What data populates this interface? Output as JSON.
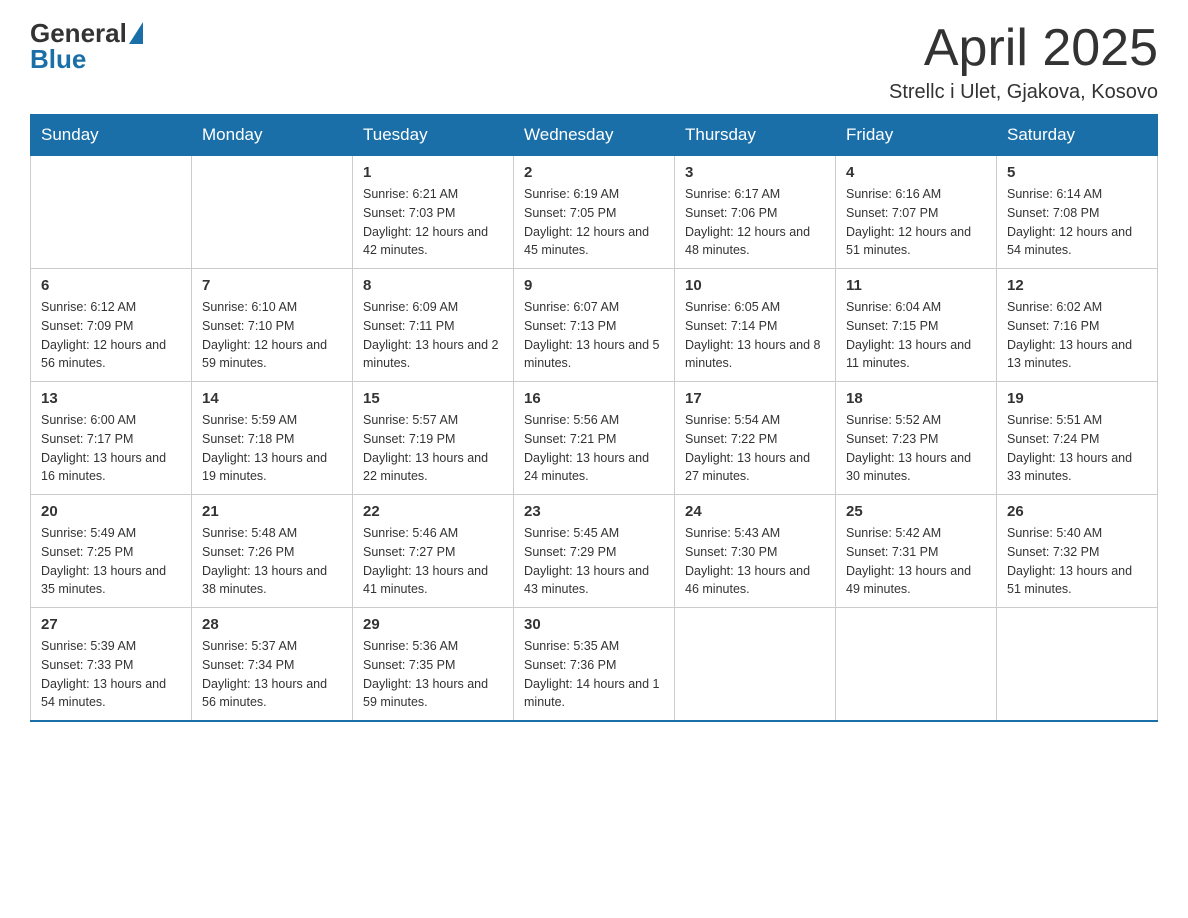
{
  "header": {
    "logo": {
      "general": "General",
      "blue": "Blue",
      "triangle_symbol": "▲"
    },
    "month_title": "April 2025",
    "location": "Strellc i Ulet, Gjakova, Kosovo"
  },
  "weekdays": [
    "Sunday",
    "Monday",
    "Tuesday",
    "Wednesday",
    "Thursday",
    "Friday",
    "Saturday"
  ],
  "weeks": [
    [
      {
        "day": "",
        "sunrise": "",
        "sunset": "",
        "daylight": ""
      },
      {
        "day": "",
        "sunrise": "",
        "sunset": "",
        "daylight": ""
      },
      {
        "day": "1",
        "sunrise": "Sunrise: 6:21 AM",
        "sunset": "Sunset: 7:03 PM",
        "daylight": "Daylight: 12 hours and 42 minutes."
      },
      {
        "day": "2",
        "sunrise": "Sunrise: 6:19 AM",
        "sunset": "Sunset: 7:05 PM",
        "daylight": "Daylight: 12 hours and 45 minutes."
      },
      {
        "day": "3",
        "sunrise": "Sunrise: 6:17 AM",
        "sunset": "Sunset: 7:06 PM",
        "daylight": "Daylight: 12 hours and 48 minutes."
      },
      {
        "day": "4",
        "sunrise": "Sunrise: 6:16 AM",
        "sunset": "Sunset: 7:07 PM",
        "daylight": "Daylight: 12 hours and 51 minutes."
      },
      {
        "day": "5",
        "sunrise": "Sunrise: 6:14 AM",
        "sunset": "Sunset: 7:08 PM",
        "daylight": "Daylight: 12 hours and 54 minutes."
      }
    ],
    [
      {
        "day": "6",
        "sunrise": "Sunrise: 6:12 AM",
        "sunset": "Sunset: 7:09 PM",
        "daylight": "Daylight: 12 hours and 56 minutes."
      },
      {
        "day": "7",
        "sunrise": "Sunrise: 6:10 AM",
        "sunset": "Sunset: 7:10 PM",
        "daylight": "Daylight: 12 hours and 59 minutes."
      },
      {
        "day": "8",
        "sunrise": "Sunrise: 6:09 AM",
        "sunset": "Sunset: 7:11 PM",
        "daylight": "Daylight: 13 hours and 2 minutes."
      },
      {
        "day": "9",
        "sunrise": "Sunrise: 6:07 AM",
        "sunset": "Sunset: 7:13 PM",
        "daylight": "Daylight: 13 hours and 5 minutes."
      },
      {
        "day": "10",
        "sunrise": "Sunrise: 6:05 AM",
        "sunset": "Sunset: 7:14 PM",
        "daylight": "Daylight: 13 hours and 8 minutes."
      },
      {
        "day": "11",
        "sunrise": "Sunrise: 6:04 AM",
        "sunset": "Sunset: 7:15 PM",
        "daylight": "Daylight: 13 hours and 11 minutes."
      },
      {
        "day": "12",
        "sunrise": "Sunrise: 6:02 AM",
        "sunset": "Sunset: 7:16 PM",
        "daylight": "Daylight: 13 hours and 13 minutes."
      }
    ],
    [
      {
        "day": "13",
        "sunrise": "Sunrise: 6:00 AM",
        "sunset": "Sunset: 7:17 PM",
        "daylight": "Daylight: 13 hours and 16 minutes."
      },
      {
        "day": "14",
        "sunrise": "Sunrise: 5:59 AM",
        "sunset": "Sunset: 7:18 PM",
        "daylight": "Daylight: 13 hours and 19 minutes."
      },
      {
        "day": "15",
        "sunrise": "Sunrise: 5:57 AM",
        "sunset": "Sunset: 7:19 PM",
        "daylight": "Daylight: 13 hours and 22 minutes."
      },
      {
        "day": "16",
        "sunrise": "Sunrise: 5:56 AM",
        "sunset": "Sunset: 7:21 PM",
        "daylight": "Daylight: 13 hours and 24 minutes."
      },
      {
        "day": "17",
        "sunrise": "Sunrise: 5:54 AM",
        "sunset": "Sunset: 7:22 PM",
        "daylight": "Daylight: 13 hours and 27 minutes."
      },
      {
        "day": "18",
        "sunrise": "Sunrise: 5:52 AM",
        "sunset": "Sunset: 7:23 PM",
        "daylight": "Daylight: 13 hours and 30 minutes."
      },
      {
        "day": "19",
        "sunrise": "Sunrise: 5:51 AM",
        "sunset": "Sunset: 7:24 PM",
        "daylight": "Daylight: 13 hours and 33 minutes."
      }
    ],
    [
      {
        "day": "20",
        "sunrise": "Sunrise: 5:49 AM",
        "sunset": "Sunset: 7:25 PM",
        "daylight": "Daylight: 13 hours and 35 minutes."
      },
      {
        "day": "21",
        "sunrise": "Sunrise: 5:48 AM",
        "sunset": "Sunset: 7:26 PM",
        "daylight": "Daylight: 13 hours and 38 minutes."
      },
      {
        "day": "22",
        "sunrise": "Sunrise: 5:46 AM",
        "sunset": "Sunset: 7:27 PM",
        "daylight": "Daylight: 13 hours and 41 minutes."
      },
      {
        "day": "23",
        "sunrise": "Sunrise: 5:45 AM",
        "sunset": "Sunset: 7:29 PM",
        "daylight": "Daylight: 13 hours and 43 minutes."
      },
      {
        "day": "24",
        "sunrise": "Sunrise: 5:43 AM",
        "sunset": "Sunset: 7:30 PM",
        "daylight": "Daylight: 13 hours and 46 minutes."
      },
      {
        "day": "25",
        "sunrise": "Sunrise: 5:42 AM",
        "sunset": "Sunset: 7:31 PM",
        "daylight": "Daylight: 13 hours and 49 minutes."
      },
      {
        "day": "26",
        "sunrise": "Sunrise: 5:40 AM",
        "sunset": "Sunset: 7:32 PM",
        "daylight": "Daylight: 13 hours and 51 minutes."
      }
    ],
    [
      {
        "day": "27",
        "sunrise": "Sunrise: 5:39 AM",
        "sunset": "Sunset: 7:33 PM",
        "daylight": "Daylight: 13 hours and 54 minutes."
      },
      {
        "day": "28",
        "sunrise": "Sunrise: 5:37 AM",
        "sunset": "Sunset: 7:34 PM",
        "daylight": "Daylight: 13 hours and 56 minutes."
      },
      {
        "day": "29",
        "sunrise": "Sunrise: 5:36 AM",
        "sunset": "Sunset: 7:35 PM",
        "daylight": "Daylight: 13 hours and 59 minutes."
      },
      {
        "day": "30",
        "sunrise": "Sunrise: 5:35 AM",
        "sunset": "Sunset: 7:36 PM",
        "daylight": "Daylight: 14 hours and 1 minute."
      },
      {
        "day": "",
        "sunrise": "",
        "sunset": "",
        "daylight": ""
      },
      {
        "day": "",
        "sunrise": "",
        "sunset": "",
        "daylight": ""
      },
      {
        "day": "",
        "sunrise": "",
        "sunset": "",
        "daylight": ""
      }
    ]
  ]
}
